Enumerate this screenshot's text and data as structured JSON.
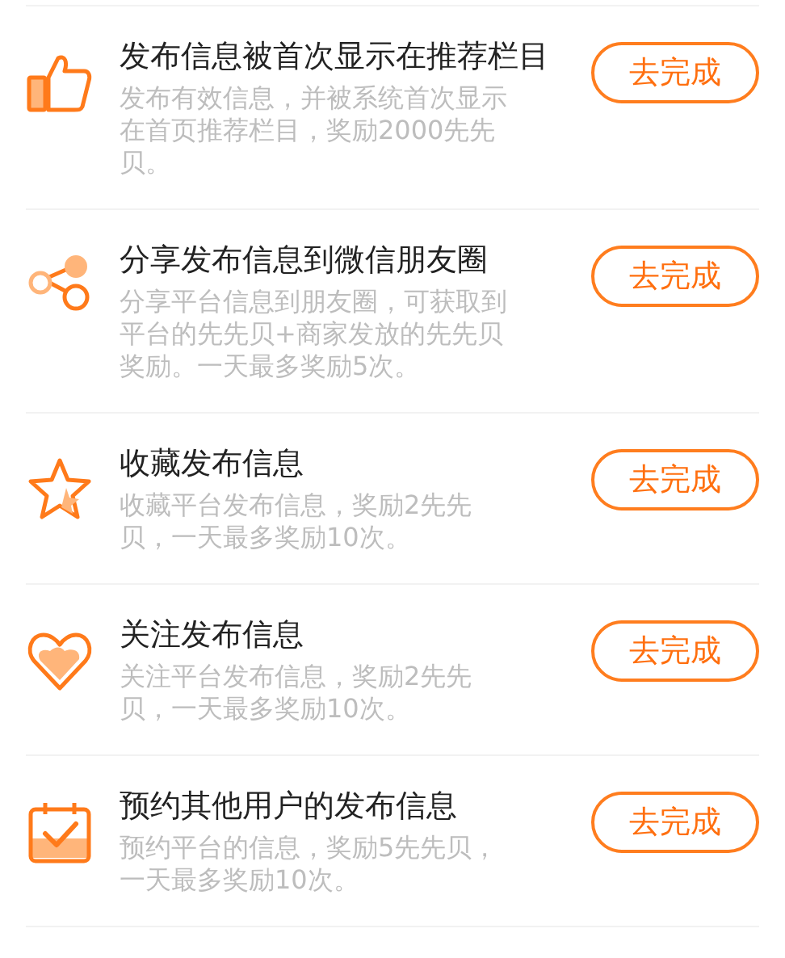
{
  "tasks": [
    {
      "title": "发布信息被首次显示在推荐栏目",
      "description": "发布有效信息，并被系统首次显示在首页推荐栏目，奖励2000先先贝。",
      "button": "去完成"
    },
    {
      "title": "分享发布信息到微信朋友圈",
      "description": "分享平台信息到朋友圈，可获取到平台的先先贝+商家发放的先先贝奖励。一天最多奖励5次。",
      "button": "去完成"
    },
    {
      "title": "收藏发布信息",
      "description": "收藏平台发布信息，奖励2先先贝，一天最多奖励10次。",
      "button": "去完成"
    },
    {
      "title": "关注发布信息",
      "description": "关注平台发布信息，奖励2先先贝，一天最多奖励10次。",
      "button": "去完成"
    },
    {
      "title": "预约其他用户的发布信息",
      "description": "预约平台的信息，奖励5先先贝，一天最多奖励10次。",
      "button": "去完成"
    }
  ]
}
